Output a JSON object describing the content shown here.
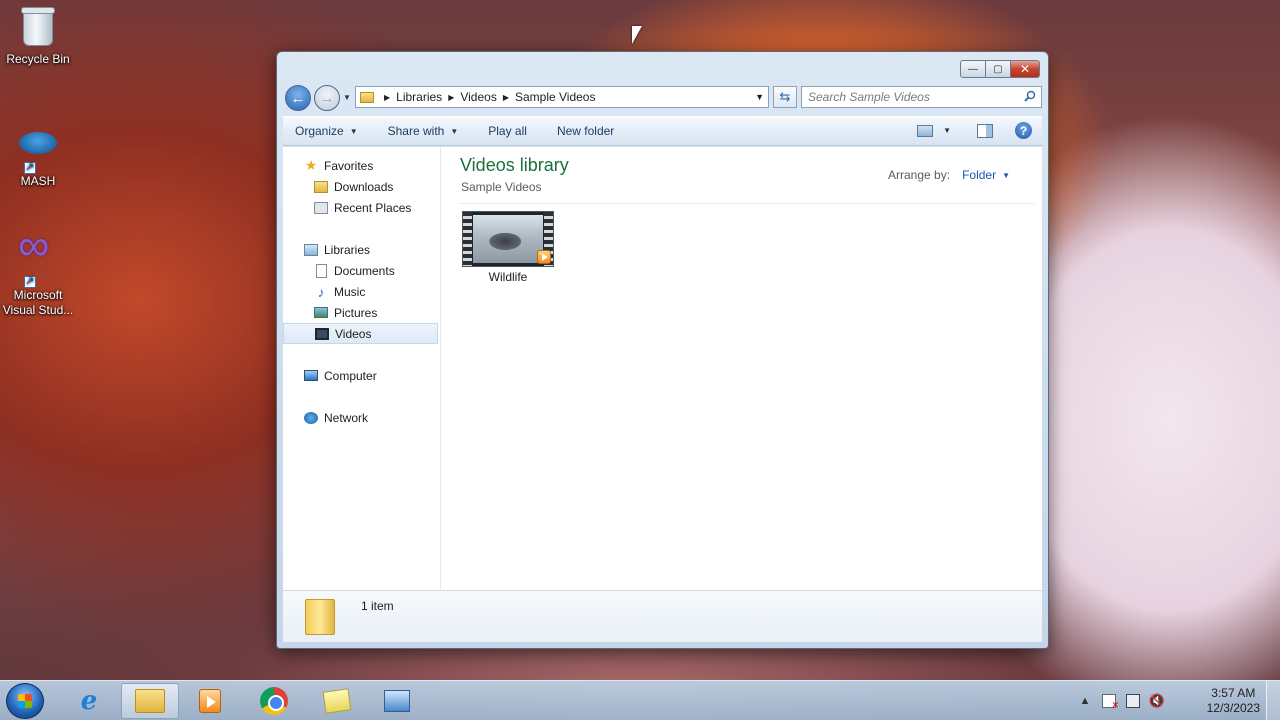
{
  "desktop": {
    "icons": [
      {
        "label": "Recycle Bin",
        "icon": "recycle-bin-icon"
      },
      {
        "label": "MASH",
        "icon": "mash-app-icon"
      },
      {
        "label": "Microsoft Visual Stud...",
        "icon": "visual-studio-icon"
      }
    ]
  },
  "window": {
    "controls": {
      "minimize": "—",
      "maximize": "▢",
      "close": "✕"
    },
    "address": {
      "crumbs": [
        "Libraries",
        "Videos",
        "Sample Videos"
      ]
    },
    "search": {
      "placeholder": "Search Sample Videos"
    },
    "toolbar": {
      "organize": "Organize",
      "share_with": "Share with",
      "play_all": "Play all",
      "new_folder": "New folder",
      "help": "?"
    },
    "nav": {
      "favorites": "Favorites",
      "downloads": "Downloads",
      "recent_places": "Recent Places",
      "libraries": "Libraries",
      "documents": "Documents",
      "music": "Music",
      "pictures": "Pictures",
      "videos": "Videos",
      "computer": "Computer",
      "network": "Network"
    },
    "content": {
      "title": "Videos library",
      "subtitle": "Sample Videos",
      "arrange_label": "Arrange by:",
      "arrange_value": "Folder",
      "items": [
        {
          "name": "Wildlife",
          "icon": "video-thumbnail-icon"
        }
      ]
    },
    "details": {
      "item_count": "1 item"
    }
  },
  "taskbar": {
    "pinned": [
      "internet-explorer-icon",
      "windows-explorer-icon",
      "media-player-icon",
      "chrome-icon",
      "sticky-notes-icon",
      "network-app-icon"
    ],
    "clock": {
      "time": "3:57 AM",
      "date": "12/3/2023"
    },
    "tray_expand": "▲"
  },
  "colors": {
    "library_title": "#1a6f3a",
    "link_blue": "#1c56b4",
    "close_red": "#c7452f"
  }
}
